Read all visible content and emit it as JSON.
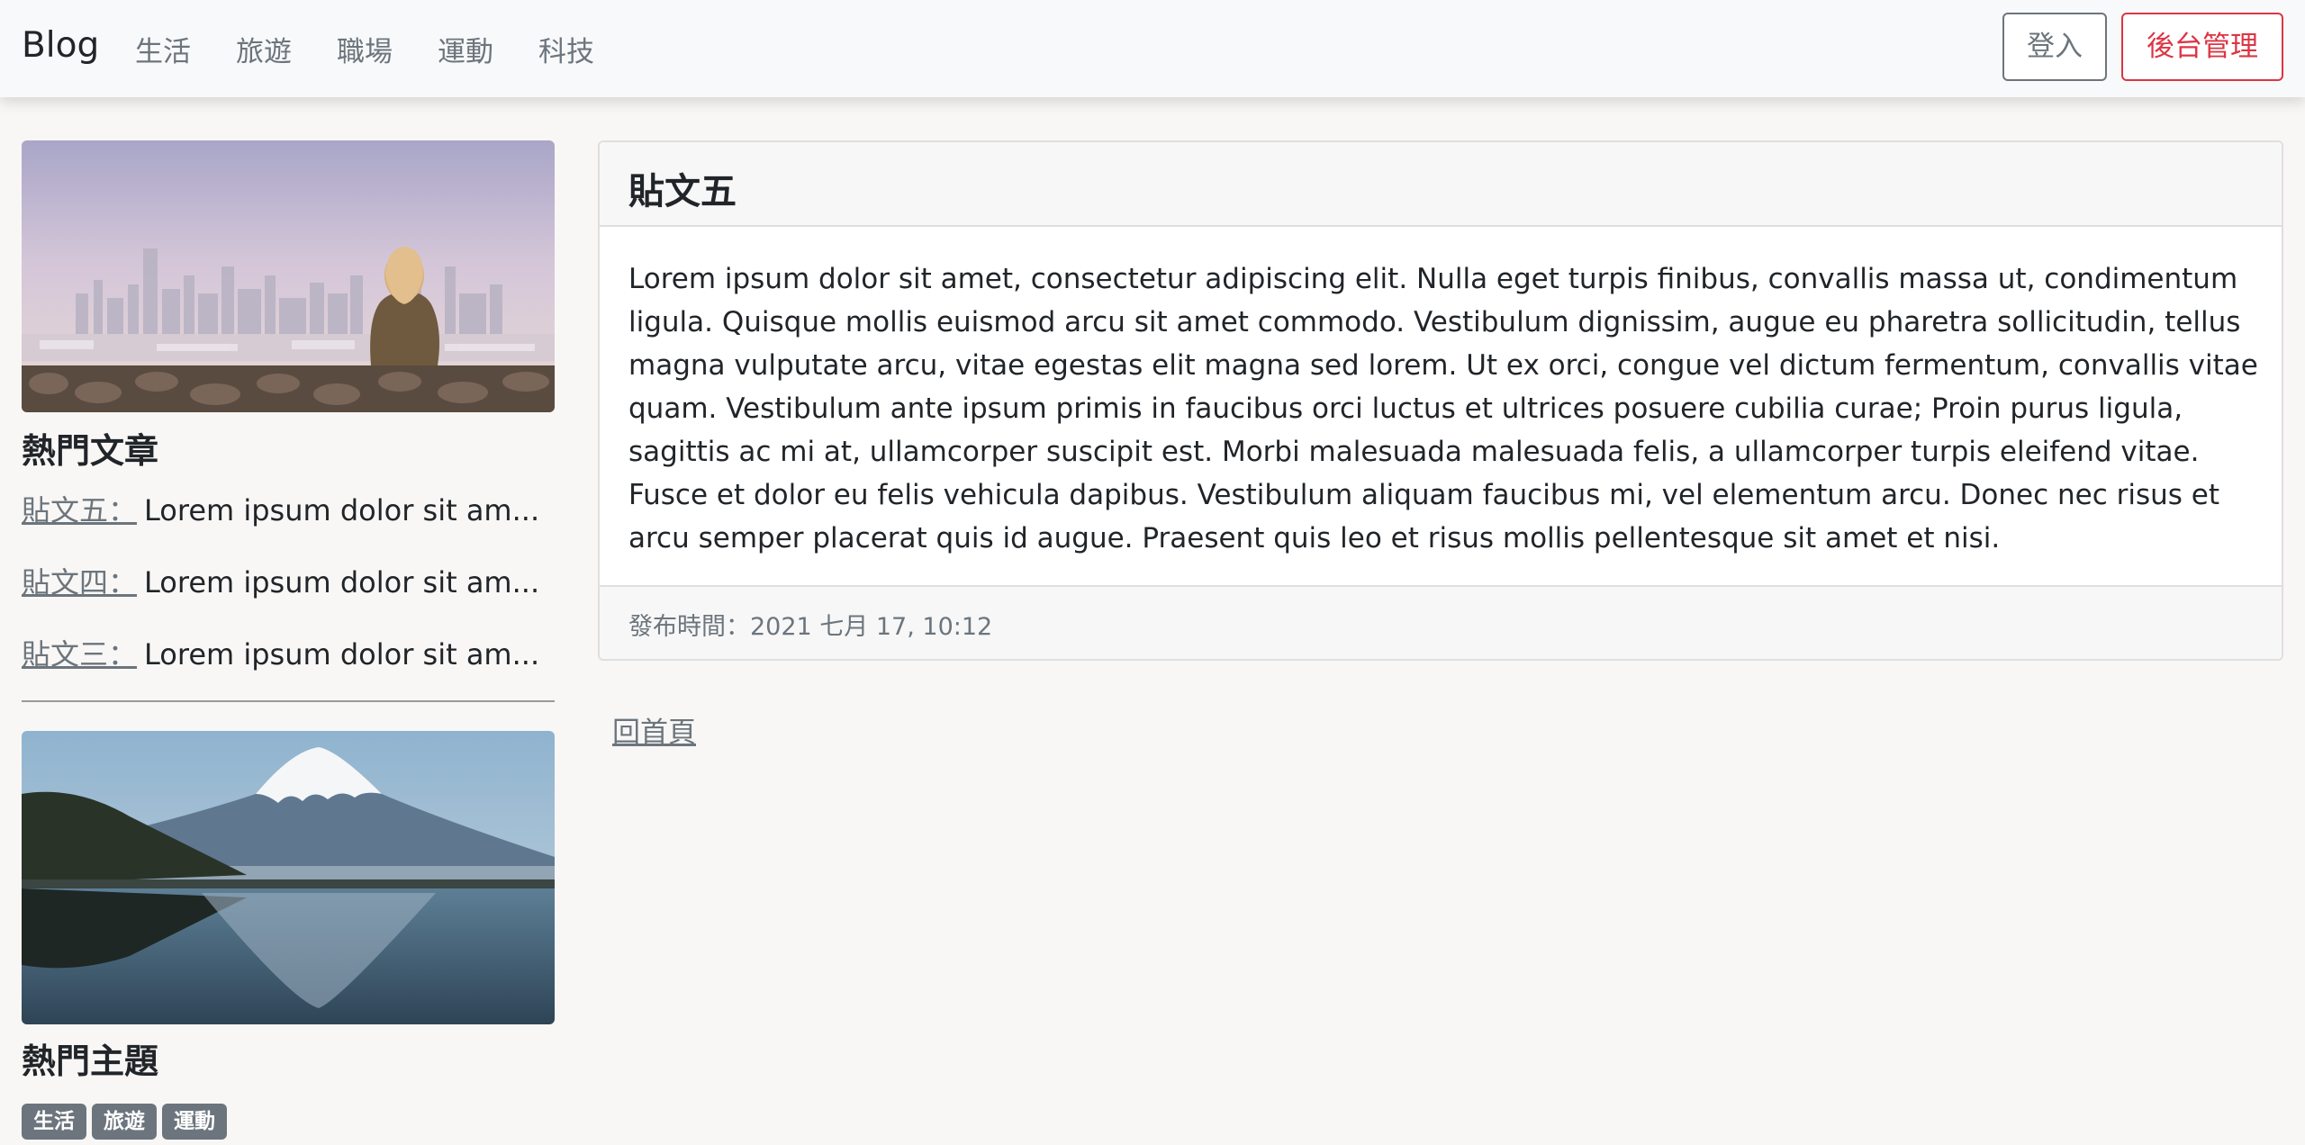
{
  "navbar": {
    "brand": "Blog",
    "items": [
      {
        "label": "生活"
      },
      {
        "label": "旅遊"
      },
      {
        "label": "職場"
      },
      {
        "label": "運動"
      },
      {
        "label": "科技"
      }
    ],
    "login_label": "登入",
    "admin_label": "後台管理"
  },
  "sidebar": {
    "popular_posts_heading": "熱門文章",
    "posts": [
      {
        "title": "貼文五：",
        "excerpt": "Lorem ipsum dolor sit am..."
      },
      {
        "title": "貼文四：",
        "excerpt": "Lorem ipsum dolor sit am..."
      },
      {
        "title": "貼文三：",
        "excerpt": "Lorem ipsum dolor sit am..."
      }
    ],
    "popular_topics_heading": "熱門主題",
    "tags": [
      {
        "label": "生活"
      },
      {
        "label": "旅遊"
      },
      {
        "label": "運動"
      }
    ]
  },
  "post": {
    "title": "貼文五",
    "body": "Lorem ipsum dolor sit amet, consectetur adipiscing elit. Nulla eget turpis finibus, convallis massa ut, condimentum ligula. Quisque mollis euismod arcu sit amet commodo. Vestibulum dignissim, augue eu pharetra sollicitudin, tellus magna vulputate arcu, vitae egestas elit magna sed lorem. Ut ex orci, congue vel dictum fermentum, convallis vitae quam. Vestibulum ante ipsum primis in faucibus orci luctus et ultrices posuere cubilia curae; Proin purus ligula, sagittis ac mi at, ullamcorper suscipit est. Morbi malesuada malesuada felis, a ullamcorper turpis eleifend vitae. Fusce et dolor eu felis vehicula dapibus. Vestibulum aliquam faucibus mi, vel elementum arcu. Donec nec risus et arcu semper placerat quis id augue. Praesent quis leo et risus mollis pellentesque sit amet et nisi.",
    "published": "發布時間：2021 七月 17, 10:12"
  },
  "home_link": "回首頁",
  "colors": {
    "navbar_bg": "#f8f9fa",
    "admin_accent": "#dc3545",
    "muted": "#6c757d",
    "page_bg": "#f8f7f5"
  }
}
